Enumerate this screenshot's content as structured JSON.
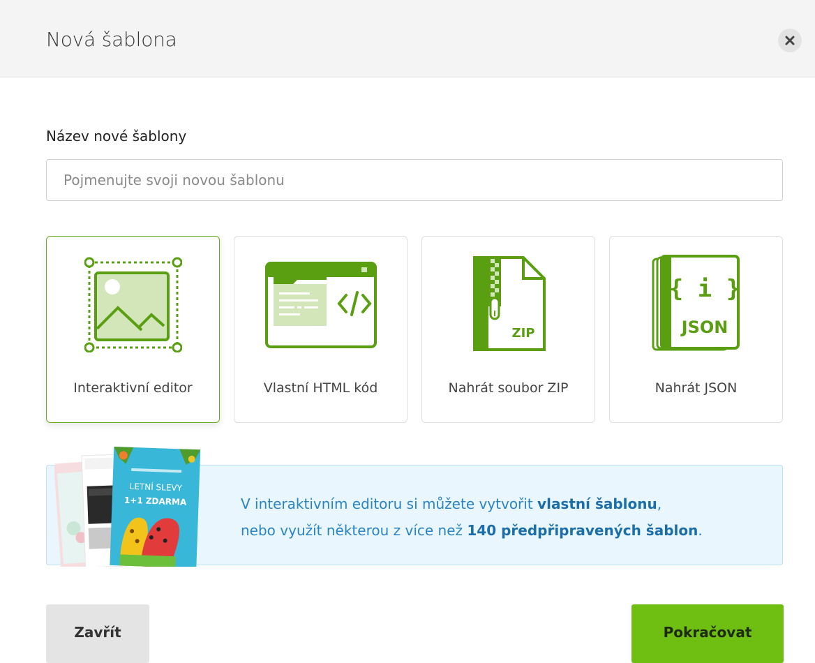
{
  "header": {
    "title": "Nová šablona",
    "close_icon": "close-icon"
  },
  "form": {
    "name_label": "Název nové šablony",
    "name_placeholder": "Pojmenujte svoji novou šablonu",
    "name_value": ""
  },
  "options": [
    {
      "label": "Interaktivní editor",
      "icon": "image-editor-icon",
      "selected": true
    },
    {
      "label": "Vlastní HTML kód",
      "icon": "html-code-icon",
      "selected": false
    },
    {
      "label": "Nahrát soubor ZIP",
      "icon": "zip-file-icon",
      "selected": false
    },
    {
      "label": "Nahrát JSON",
      "icon": "json-file-icon",
      "selected": false
    }
  ],
  "icon_text": {
    "zip": "ZIP",
    "json_braces": "{ i }",
    "json": "JSON"
  },
  "info": {
    "line1_pre": "V interaktivním editoru si můžete vytvořit ",
    "line1_bold": "vlastní šablonu",
    "line1_post": ",",
    "line2_pre": "nebo využít některou z více než ",
    "line2_bold": "140 předpřipravených šablon",
    "line2_post": ".",
    "thumb_text_1": "LETNÍ SLEVY",
    "thumb_text_2": "1+1 ZDARMA"
  },
  "footer": {
    "close_label": "Zavřít",
    "continue_label": "Pokračovat"
  },
  "colors": {
    "accent_green": "#6ebf12",
    "icon_green": "#5a9e12",
    "info_blue": "#2b84c2",
    "info_bg": "#e9f6fd"
  }
}
